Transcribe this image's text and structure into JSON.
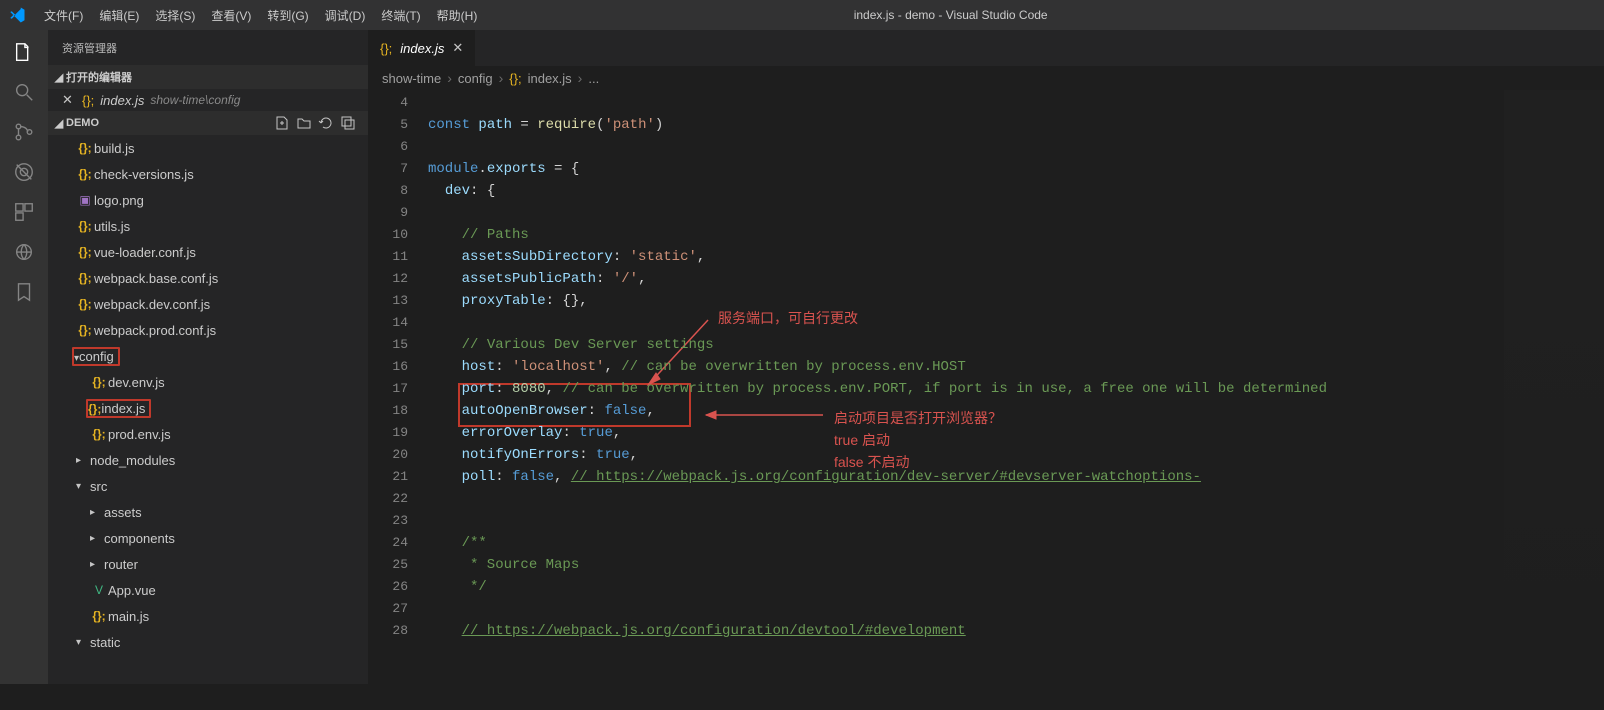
{
  "titlebar": {
    "title": "index.js - demo - Visual Studio Code",
    "menus": [
      "文件(F)",
      "编辑(E)",
      "选择(S)",
      "查看(V)",
      "转到(G)",
      "调试(D)",
      "终端(T)",
      "帮助(H)"
    ]
  },
  "sidebar": {
    "header": "资源管理器",
    "open_editors_label": "打开的编辑器",
    "open_editor_file": "index.js",
    "open_editor_path": "show-time\\config",
    "project": "DEMO",
    "tree": [
      {
        "lvl": 1,
        "type": "js",
        "label": "build.js"
      },
      {
        "lvl": 1,
        "type": "js",
        "label": "check-versions.js"
      },
      {
        "lvl": 1,
        "type": "img",
        "label": "logo.png"
      },
      {
        "lvl": 1,
        "type": "js",
        "label": "utils.js"
      },
      {
        "lvl": 1,
        "type": "js",
        "label": "vue-loader.conf.js"
      },
      {
        "lvl": 1,
        "type": "js",
        "label": "webpack.base.conf.js"
      },
      {
        "lvl": 1,
        "type": "js",
        "label": "webpack.dev.conf.js"
      },
      {
        "lvl": 1,
        "type": "js",
        "label": "webpack.prod.conf.js"
      },
      {
        "lvl": 1,
        "type": "folder-open",
        "label": "config",
        "boxed": true
      },
      {
        "lvl": 2,
        "type": "js",
        "label": "dev.env.js"
      },
      {
        "lvl": 2,
        "type": "js",
        "label": "index.js",
        "boxed": true
      },
      {
        "lvl": 2,
        "type": "js",
        "label": "prod.env.js"
      },
      {
        "lvl": 1,
        "type": "folder",
        "label": "node_modules"
      },
      {
        "lvl": 1,
        "type": "folder-open",
        "label": "src"
      },
      {
        "lvl": 2,
        "type": "folder",
        "label": "assets"
      },
      {
        "lvl": 2,
        "type": "folder",
        "label": "components"
      },
      {
        "lvl": 2,
        "type": "folder",
        "label": "router"
      },
      {
        "lvl": 2,
        "type": "vue",
        "label": "App.vue"
      },
      {
        "lvl": 2,
        "type": "js",
        "label": "main.js"
      },
      {
        "lvl": 1,
        "type": "folder-open",
        "label": "static"
      }
    ]
  },
  "tab_label": "index.js",
  "breadcrumbs": [
    "show-time",
    "config",
    "index.js",
    "..."
  ],
  "code_start_line": 4,
  "code_lines": [
    {
      "t": ""
    },
    {
      "t": "const path = require('path')"
    },
    {
      "t": ""
    },
    {
      "t": "module.exports = {"
    },
    {
      "t": "  dev: {"
    },
    {
      "t": ""
    },
    {
      "t": "    // Paths"
    },
    {
      "t": "    assetsSubDirectory: 'static',"
    },
    {
      "t": "    assetsPublicPath: '/',"
    },
    {
      "t": "    proxyTable: {},"
    },
    {
      "t": ""
    },
    {
      "t": "    // Various Dev Server settings"
    },
    {
      "t": "    host: 'localhost', // can be overwritten by process.env.HOST"
    },
    {
      "t": "    port: 8080, // can be overwritten by process.env.PORT, if port is in use, a free one will be determined"
    },
    {
      "t": "    autoOpenBrowser: false,"
    },
    {
      "t": "    errorOverlay: true,"
    },
    {
      "t": "    notifyOnErrors: true,"
    },
    {
      "t": "    poll: false, // https://webpack.js.org/configuration/dev-server/#devserver-watchoptions-"
    },
    {
      "t": ""
    },
    {
      "t": ""
    },
    {
      "t": "    /**"
    },
    {
      "t": "     * Source Maps"
    },
    {
      "t": "     */"
    },
    {
      "t": ""
    },
    {
      "t": "    // https://webpack.js.org/configuration/devtool/#development"
    }
  ],
  "annotations": {
    "a1": "服务端口，可自行更改",
    "a2": "启动项目是否打开浏览器？",
    "a3": "true 启动",
    "a4": "false 不启动"
  }
}
